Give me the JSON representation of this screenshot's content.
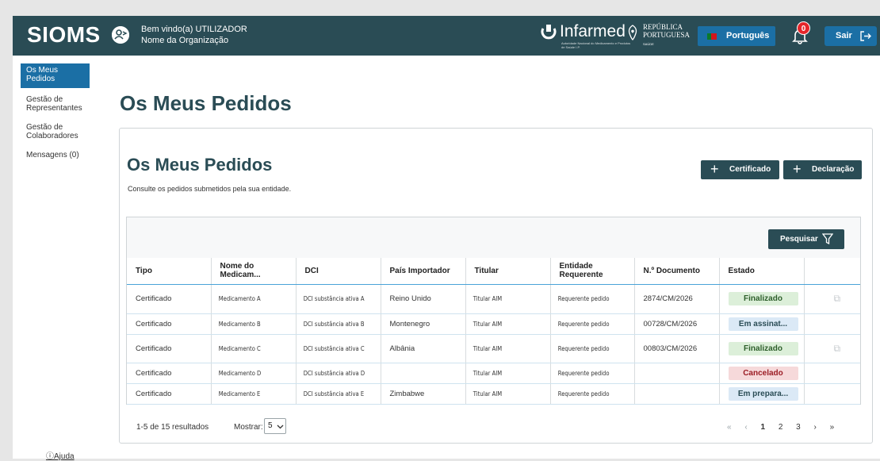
{
  "header": {
    "app_title": "SIOMS",
    "welcome_line1": "Bem vindo(a) UTILIZADOR",
    "welcome_line2": "Nome da Organização",
    "infarmed_name": "Infarmed",
    "infarmed_sub": "Autoridade Nacional do Medicamento e Produtos de Saúde I.P.",
    "republica_line1": "REPÚBLICA",
    "republica_line2": "PORTUGUESA",
    "republica_sub": "SAÚDE",
    "language": "Português",
    "notifications_count": "0",
    "logout_label": "Sair"
  },
  "sidebar": {
    "items": [
      {
        "label": "Os Meus Pedidos"
      },
      {
        "label": "Gestão de Representantes"
      },
      {
        "label": "Gestão de Colaboradores"
      },
      {
        "label": "Mensagens (0)"
      }
    ],
    "help_label": "Ajuda"
  },
  "page": {
    "title": "Os Meus Pedidos",
    "card_title": "Os Meus Pedidos",
    "card_subtitle": "Consulte os pedidos submetidos pela sua entidade.",
    "btn_certificado": "Certificado",
    "btn_declaracao": "Declaração",
    "btn_pesquisar": "Pesquisar"
  },
  "table": {
    "columns": [
      "Tipo",
      "Nome do Medicam...",
      "DCI",
      "País Importador",
      "Titular",
      "Entidade Requerente",
      "N.º Documento",
      "Estado",
      ""
    ],
    "rows": [
      {
        "tipo": "Certificado",
        "nome": "Medicamento A",
        "dci": "DCI substância ativa A",
        "pais": "Reino Unido",
        "titular": "Titular AIM",
        "entidade": "Requerente pedido",
        "documento": "2874/CM/2026",
        "estado": "Finalizado",
        "estado_kind": "fin",
        "copy": true
      },
      {
        "tipo": "Certificado",
        "nome": "Medicamento B",
        "dci": "DCI substância ativa B",
        "pais": "Montenegro",
        "titular": "Titular AIM",
        "entidade": "Requerente pedido",
        "documento": "00728/CM/2026",
        "estado": "Em assinat...",
        "estado_kind": "ass",
        "copy": false
      },
      {
        "tipo": "Certificado",
        "nome": "Medicamento C",
        "dci": "DCI substância ativa C",
        "pais": "Albânia",
        "titular": "Titular AIM",
        "entidade": "Requerente pedido",
        "documento": "00803/CM/2026",
        "estado": "Finalizado",
        "estado_kind": "fin",
        "copy": true
      },
      {
        "tipo": "Certificado",
        "nome": "Medicamento D",
        "dci": "DCI substância ativa D",
        "pais": "",
        "titular": "Titular AIM",
        "entidade": "Requerente pedido",
        "documento": "",
        "estado": "Cancelado",
        "estado_kind": "can",
        "copy": false
      },
      {
        "tipo": "Certificado",
        "nome": "Medicamento E",
        "dci": "DCI substância ativa E",
        "pais": "Zimbabwe",
        "titular": "Titular AIM",
        "entidade": "Requerente pedido",
        "documento": "",
        "estado": "Em prepara...",
        "estado_kind": "pre",
        "copy": false
      }
    ]
  },
  "footer": {
    "results": "1-5 de 15 resultados",
    "show_label": "Mostrar:",
    "page_size": "5",
    "pages": [
      "1",
      "2",
      "3"
    ],
    "current_page": "1"
  }
}
